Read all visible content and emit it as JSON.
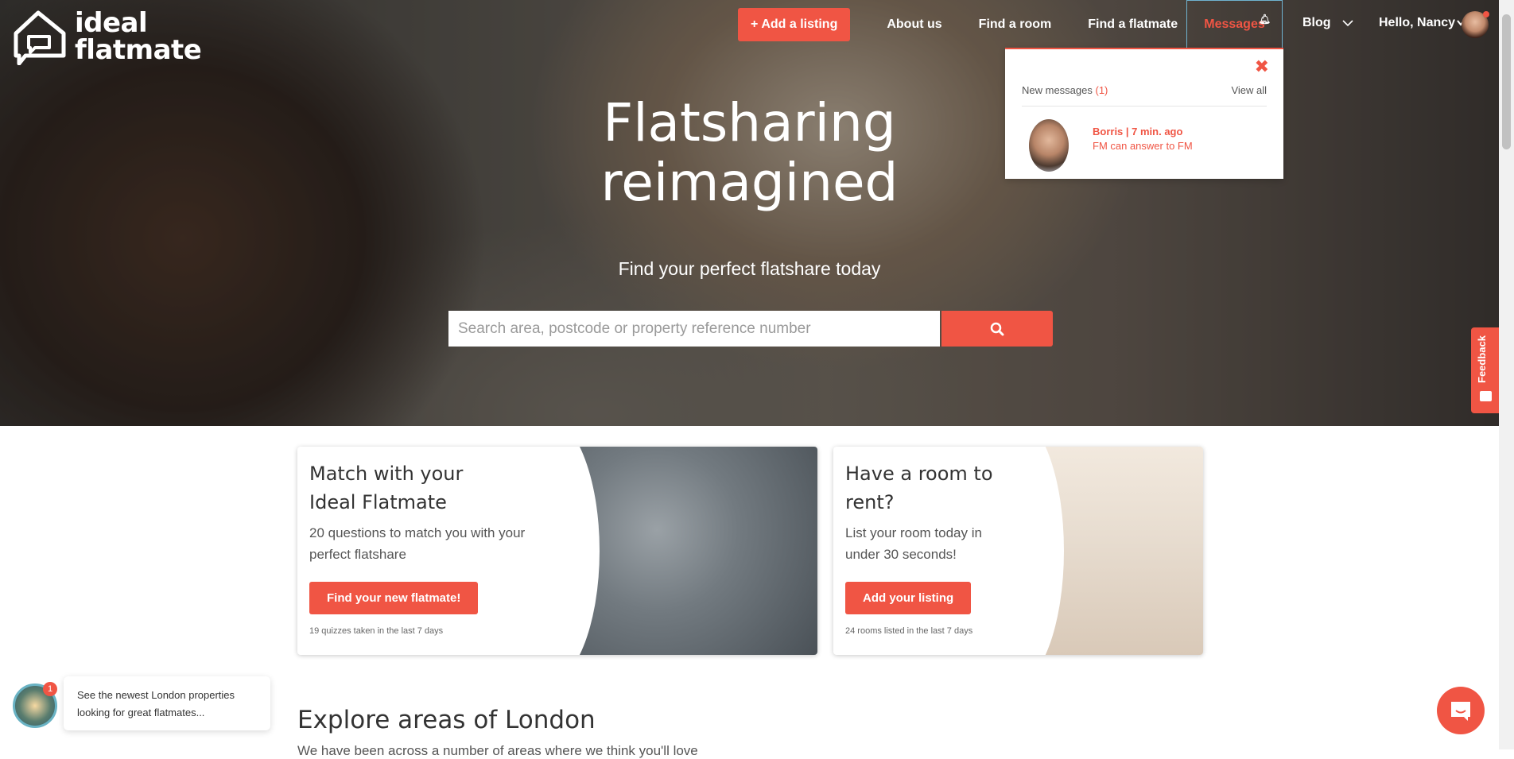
{
  "brand": {
    "line1": "ideal",
    "line2": "flatmate"
  },
  "nav": {
    "add_listing": "Add a listing",
    "about": "About us",
    "find_room": "Find a room",
    "find_flatmate": "Find a flatmate",
    "messages": "Messages",
    "blog": "Blog",
    "user_greeting": "Hello, Nancy"
  },
  "messages_popup": {
    "label": "New messages",
    "count": "(1)",
    "view_all": "View all",
    "item": {
      "from": "Borris | 7 min. ago",
      "text": "FM can answer to FM"
    }
  },
  "hero": {
    "title_line1": "Flatsharing",
    "title_line2": "reimagined",
    "subtitle": "Find your perfect flatshare today",
    "search_placeholder": "Search area, postcode or property reference number"
  },
  "feedback": {
    "label": "Feedback"
  },
  "cards": [
    {
      "title_line1": "Match with your",
      "title_line2": "Ideal Flatmate",
      "text_line1": "20 questions to match you with your",
      "text_line2": "perfect flatshare",
      "button": "Find your new flatmate!",
      "note": "19 quizzes taken in the last 7 days"
    },
    {
      "title_line1": "Have a room to",
      "title_line2": "rent?",
      "text_line1": "List your room today in",
      "text_line2": "under 30 seconds!",
      "button": "Add your listing",
      "note": "24 rooms listed in the last 7 days"
    }
  ],
  "explore": {
    "title": "Explore areas of London",
    "subtitle": "We have been across a number of areas where we think you'll love"
  },
  "chat": {
    "badge": "1",
    "line1": "See the newest London properties",
    "line2": "looking for great flatmates..."
  },
  "colors": {
    "accent": "#f05544",
    "text_dark": "#333333"
  }
}
